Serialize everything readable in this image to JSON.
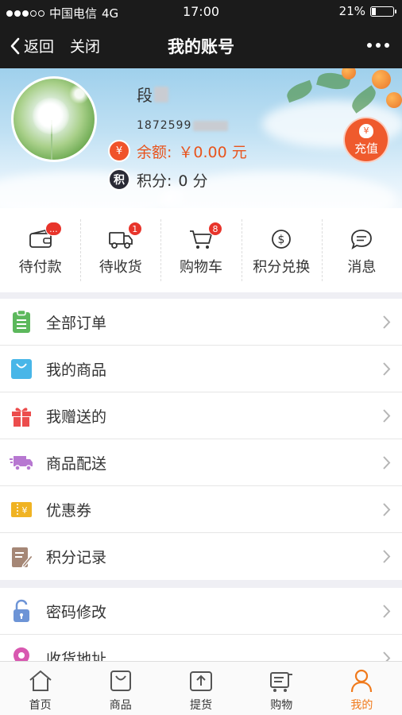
{
  "status_bar": {
    "carrier": "中国电信",
    "network": "4G",
    "time": "17:00",
    "battery": "21%",
    "battery_level": 0.21
  },
  "nav": {
    "back_label": "返回",
    "close_label": "关闭",
    "title": "我的账号"
  },
  "profile": {
    "name": "段",
    "phone": "1872599",
    "balance_label": "余额:",
    "balance_value": "￥0.00 元",
    "points_label": "积分:",
    "points_value": "0 分",
    "money_icon_glyph": "¥",
    "points_icon_glyph": "积",
    "recharge_label": "充值",
    "recharge_glyph": "¥"
  },
  "quick_actions": [
    {
      "label": "待付款",
      "icon": "wallet-icon",
      "badge": "..."
    },
    {
      "label": "待收货",
      "icon": "truck-icon",
      "badge": "1"
    },
    {
      "label": "购物车",
      "icon": "cart-icon",
      "badge": "8"
    },
    {
      "label": "积分兑换",
      "icon": "coin-icon",
      "badge": ""
    },
    {
      "label": "消息",
      "icon": "message-icon",
      "badge": ""
    }
  ],
  "menu_group_1": [
    {
      "label": "全部订单",
      "icon": "clipboard-icon",
      "color": "#5cb85c"
    },
    {
      "label": "我的商品",
      "icon": "shopping-bag-icon",
      "color": "#48b6e8"
    },
    {
      "label": "我赠送的",
      "icon": "gift-icon",
      "color": "#ec4d4d"
    },
    {
      "label": "商品配送",
      "icon": "delivery-truck-icon",
      "color": "#b778d1"
    },
    {
      "label": "优惠券",
      "icon": "coupon-icon",
      "color": "#f0b323"
    },
    {
      "label": "积分记录",
      "icon": "note-edit-icon",
      "color": "#a58776"
    }
  ],
  "menu_group_2": [
    {
      "label": "密码修改",
      "icon": "lock-icon",
      "color": "#6d94d6"
    },
    {
      "label": "收货地址",
      "icon": "location-icon",
      "color": "#d858b0"
    }
  ],
  "tabs": [
    {
      "label": "首页",
      "icon": "home-icon"
    },
    {
      "label": "商品",
      "icon": "bag-icon"
    },
    {
      "label": "提货",
      "icon": "upload-icon"
    },
    {
      "label": "购物",
      "icon": "cart-icon"
    },
    {
      "label": "我的",
      "icon": "person-icon",
      "active": true
    }
  ],
  "colors": {
    "accent": "#f07a1c",
    "balance": "#e8541d",
    "nav_bg": "#1b1b1b",
    "badge": "#e8342b"
  }
}
